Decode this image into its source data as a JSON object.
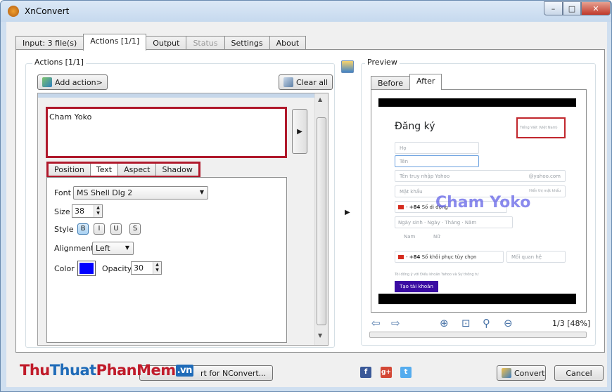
{
  "window": {
    "title": "XnConvert",
    "min_glyph": "–",
    "max_glyph": "□",
    "close_glyph": "✕"
  },
  "tabs": [
    {
      "label": "Input: 3 file(s)"
    },
    {
      "label": "Actions [1/1]",
      "active": true
    },
    {
      "label": "Output"
    },
    {
      "label": "Status",
      "disabled": true
    },
    {
      "label": "Settings"
    },
    {
      "label": "About"
    }
  ],
  "actions": {
    "group_label": "Actions [1/1]",
    "add_action_label": "Add action>",
    "clear_all_label": "Clear all",
    "text_value": "Cham Yoko",
    "subtabs": [
      {
        "label": "Position"
      },
      {
        "label": "Text",
        "active": true
      },
      {
        "label": "Aspect"
      },
      {
        "label": "Shadow"
      }
    ],
    "font_label": "Font",
    "font_value": "MS Shell Dlg 2",
    "size_label": "Size",
    "size_value": "38",
    "style_label": "Style",
    "style_buttons": [
      "B",
      "I",
      "U",
      "S"
    ],
    "alignment_label": "Alignment",
    "alignment_value": "Left",
    "color_label": "Color",
    "color_value": "#0000ff",
    "opacity_label": "Opacity",
    "opacity_value": "30"
  },
  "preview": {
    "group_label": "Preview",
    "tabs": [
      {
        "label": "Before"
      },
      {
        "label": "After",
        "active": true
      }
    ],
    "counter": "1/3 [48%]",
    "image": {
      "heading": "Đăng ký",
      "language": "Tiếng Việt (Việt Nam)",
      "field_ho": "Họ",
      "field_ten": "Tên",
      "field_username": "Tên truy nhập Yahoo",
      "domain": "@yahoo.com",
      "field_password": "Mật khẩu",
      "show_password": "Hiển thị mật khẩu",
      "country_code": "+84",
      "phone_placeholder": "Số di động",
      "birth_label": "Ngày sinh",
      "birth_day": "Ngày",
      "birth_month": "Tháng",
      "birth_year": "Năm",
      "gender_male": "Nam",
      "gender_female": "Nữ",
      "recovery_phone": "Số khôi phục tùy chọn",
      "relationship": "Mối quan hệ",
      "terms": "Tôi đồng ý với Điều khoản Yahoo và Sự thống tư",
      "submit": "Tạo tài khoản",
      "watermark_text": "Cham Yoko"
    }
  },
  "bottom": {
    "nconvert_label": "rt for NConvert...",
    "convert_label": "Convert",
    "cancel_label": "Cancel",
    "watermark": {
      "part1": "Thu",
      "part2": "Thuat",
      "part3": "PhanMem",
      "part4": ".vn"
    }
  }
}
